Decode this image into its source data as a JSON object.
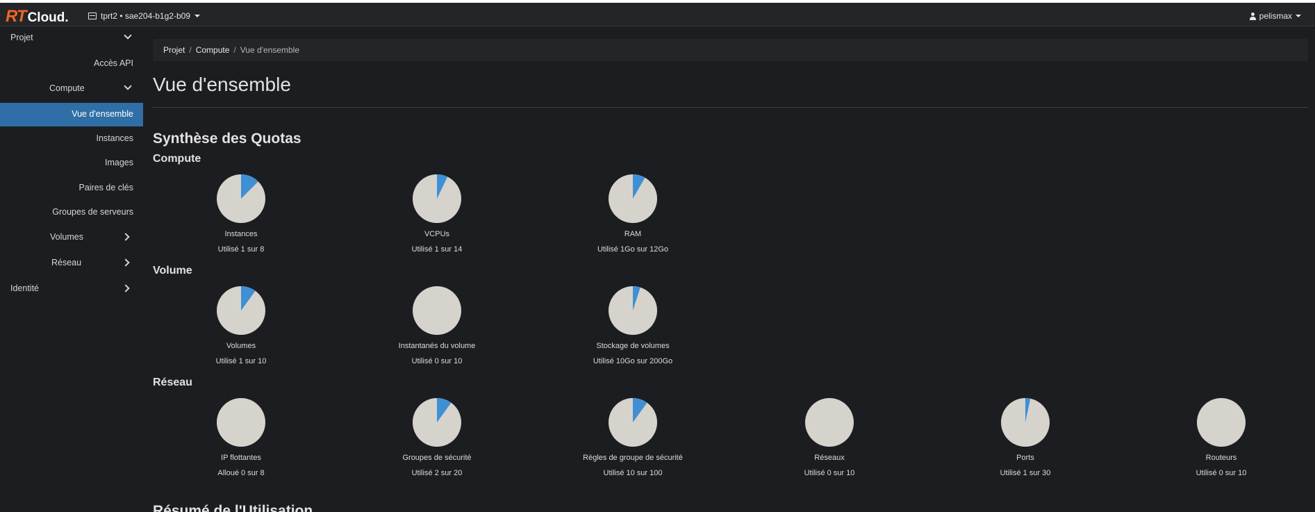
{
  "header": {
    "logo_rt": "RT",
    "logo_cloud": "Cloud.",
    "project_selector": "tprt2 • sae204-b1g2-b09",
    "user": "pelismax"
  },
  "sidebar": {
    "items": [
      {
        "label": "Projet"
      },
      {
        "label": "Accès API"
      },
      {
        "label": "Compute"
      },
      {
        "label": "Vue d'ensemble"
      },
      {
        "label": "Instances"
      },
      {
        "label": "Images"
      },
      {
        "label": "Paires de clés"
      },
      {
        "label": "Groupes de serveurs"
      },
      {
        "label": "Volumes"
      },
      {
        "label": "Réseau"
      },
      {
        "label": "Identité"
      }
    ]
  },
  "breadcrumb": {
    "items": [
      "Projet",
      "Compute",
      "Vue d'ensemble"
    ]
  },
  "page": {
    "title": "Vue d'ensemble",
    "section_title": "Synthèse des Quotas",
    "next_section": "Résumé de l'Utilisation"
  },
  "colors": {
    "used": "#3f8fd4",
    "free": "#d6d3cd",
    "accent": "#2f6ea6"
  },
  "quota_groups": [
    {
      "title": "Compute",
      "quotas": [
        {
          "label": "Instances",
          "usage": "Utilisé 1 sur 8",
          "used": 1,
          "total": 8
        },
        {
          "label": "VCPUs",
          "usage": "Utilisé 1 sur 14",
          "used": 1,
          "total": 14
        },
        {
          "label": "RAM",
          "usage": "Utilisé 1Go sur 12Go",
          "used": 1,
          "total": 12
        }
      ]
    },
    {
      "title": "Volume",
      "quotas": [
        {
          "label": "Volumes",
          "usage": "Utilisé 1 sur 10",
          "used": 1,
          "total": 10
        },
        {
          "label": "Instantanés du volume",
          "usage": "Utilisé 0 sur 10",
          "used": 0,
          "total": 10
        },
        {
          "label": "Stockage de volumes",
          "usage": "Utilisé 10Go sur 200Go",
          "used": 10,
          "total": 200
        }
      ]
    },
    {
      "title": "Réseau",
      "quotas": [
        {
          "label": "IP flottantes",
          "usage": "Alloué 0 sur 8",
          "used": 0,
          "total": 8
        },
        {
          "label": "Groupes de sécurité",
          "usage": "Utilisé 2 sur 20",
          "used": 2,
          "total": 20
        },
        {
          "label": "Règles de groupe de sécurité",
          "usage": "Utilisé 10 sur 100",
          "used": 10,
          "total": 100
        },
        {
          "label": "Réseaux",
          "usage": "Utilisé 0 sur 10",
          "used": 0,
          "total": 10
        },
        {
          "label": "Ports",
          "usage": "Utilisé 1 sur 30",
          "used": 1,
          "total": 30
        },
        {
          "label": "Routeurs",
          "usage": "Utilisé 0 sur 10",
          "used": 0,
          "total": 10
        }
      ]
    }
  ]
}
